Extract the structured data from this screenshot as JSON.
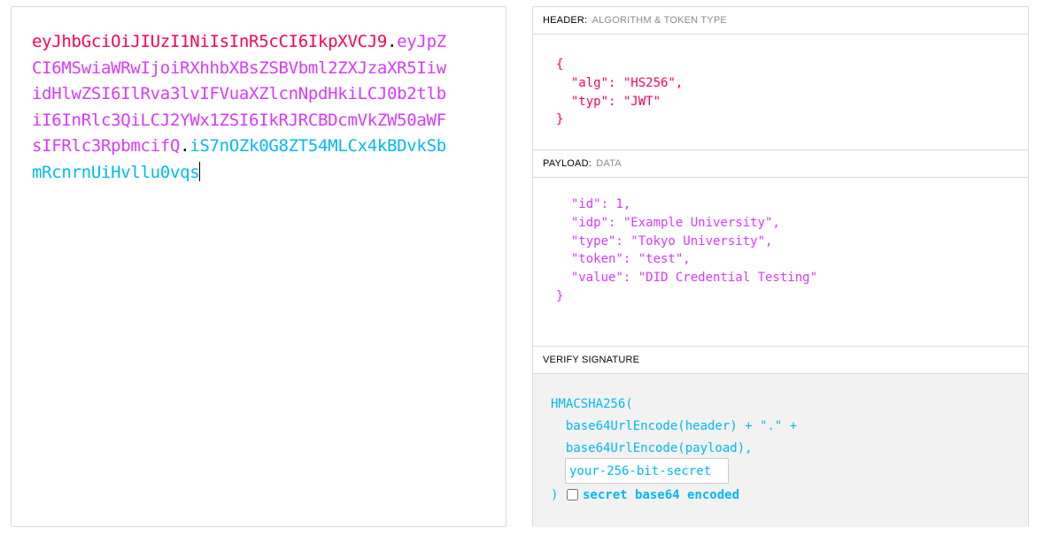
{
  "encoded": {
    "header": "eyJhbGciOiJIUzI1NiIsInR5cCI6IkpXVCJ9",
    "dot1": ".",
    "payload": "eyJpZCI6MSwiaWRwIjoiRXhhbXBsZSBVbml2ZXJzaXR5IiwidHlwZSI6IlRva3lvIFVuaXZlcnNpdHkiLCJ0b2tlbiI6InRlc3QiLCJ2YWx1ZSI6IkRJRCBDcmVkZW50aWFsIFRlc3RpbmcifQ",
    "dot2": ".",
    "signature": "iS7nOZk0G8ZT54MLCx4kBDvkSbmRcnrnUiHvllu0vqs"
  },
  "colors": {
    "header": "#fb015b",
    "payload": "#d63aff",
    "signature": "#00b9f1"
  },
  "header_section": {
    "title": "HEADER:",
    "subtitle": "ALGORITHM & TOKEN TYPE",
    "json_lines": [
      "{",
      "  \"alg\": \"HS256\",",
      "  \"typ\": \"JWT\"",
      "}"
    ]
  },
  "payload_section": {
    "title": "PAYLOAD:",
    "subtitle": "DATA",
    "json_lines": [
      "  \"id\": 1,",
      "  \"idp\": \"Example University\",",
      "  \"type\": \"Tokyo University\",",
      "  \"token\": \"test\",",
      "  \"value\": \"DID Credential Testing\"",
      "}"
    ]
  },
  "verify_section": {
    "title": "VERIFY SIGNATURE",
    "line1": "HMACSHA256(",
    "line2": "  base64UrlEncode(header) + \".\" +",
    "line3": "  base64UrlEncode(payload),",
    "secret_placeholder": "your-256-bit-secret",
    "closing": ")",
    "checkbox_label": "secret base64 encoded"
  }
}
